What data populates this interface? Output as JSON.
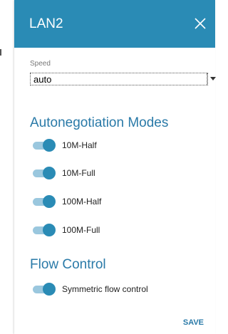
{
  "dialog": {
    "title": "LAN2",
    "close_icon": "close-icon"
  },
  "speed": {
    "label": "Speed",
    "value": "auto"
  },
  "autoneg": {
    "title": "Autonegotiation Modes",
    "items": [
      {
        "label": "10M-Half",
        "enabled": true
      },
      {
        "label": "10M-Full",
        "enabled": true
      },
      {
        "label": "100M-Half",
        "enabled": true
      },
      {
        "label": "100M-Full",
        "enabled": true
      }
    ]
  },
  "flow": {
    "title": "Flow Control",
    "items": [
      {
        "label": "Symmetric flow control",
        "enabled": true
      }
    ]
  },
  "actions": {
    "save_label": "SAVE"
  },
  "colors": {
    "accent": "#2a8bb5",
    "toggle_track": "#9ac7de",
    "section_title": "#2a7aa8"
  }
}
